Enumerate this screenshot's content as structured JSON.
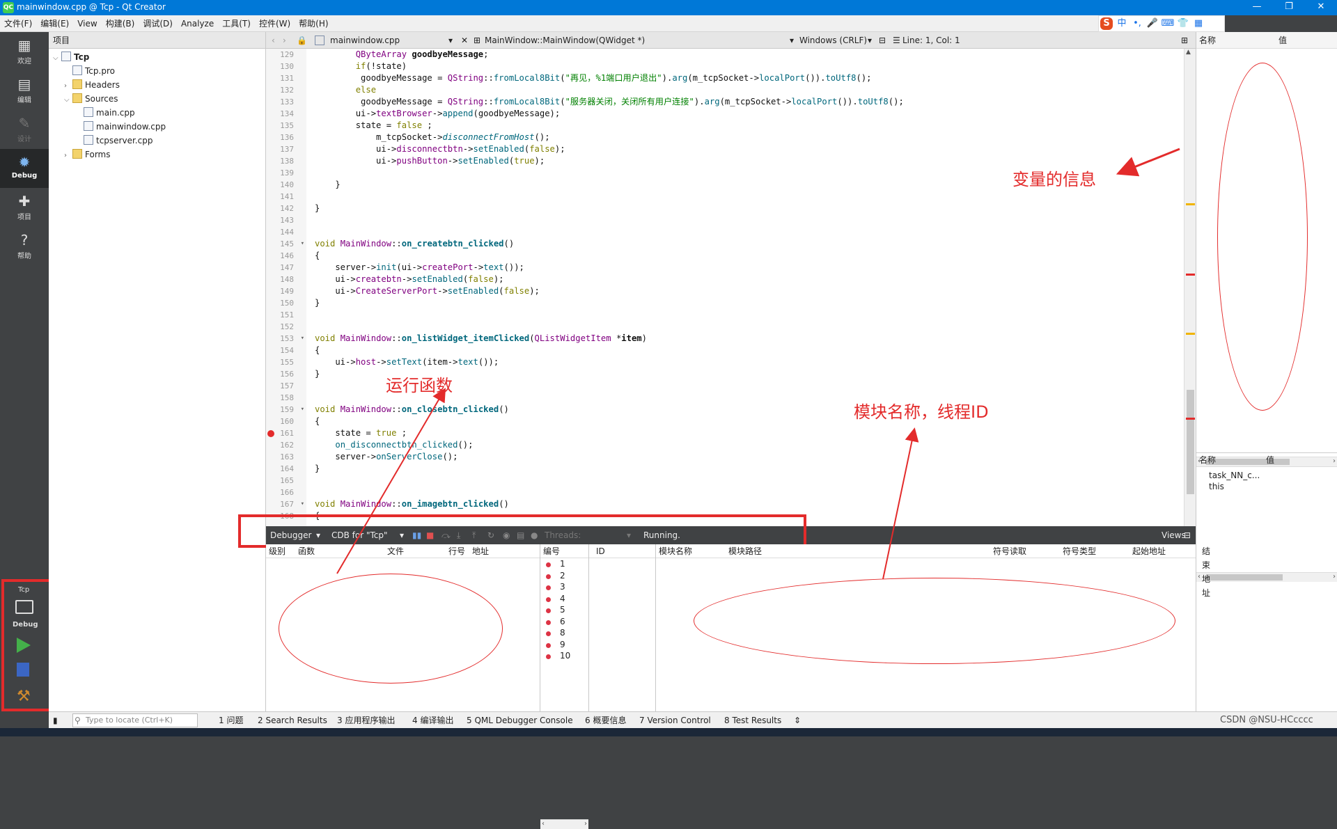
{
  "window": {
    "title": "mainwindow.cpp @ Tcp - Qt Creator",
    "logo": "QC",
    "minimize": "—",
    "restore": "❐",
    "close": "✕"
  },
  "ime": {
    "logo": "S",
    "items": [
      "中",
      "•,",
      "🎤",
      "⌨",
      "👕",
      "▦"
    ]
  },
  "menu": [
    "文件(F)",
    "编辑(E)",
    "View",
    "构建(B)",
    "调试(D)",
    "Analyze",
    "工具(T)",
    "控件(W)",
    "帮助(H)"
  ],
  "modes": [
    {
      "label": "欢迎",
      "icon": "grid-icon"
    },
    {
      "label": "编辑",
      "icon": "edit-icon"
    },
    {
      "label": "设计",
      "icon": "pen-icon"
    },
    {
      "label": "Debug",
      "icon": "bug-icon"
    },
    {
      "label": "项目",
      "icon": "wrench-icon"
    },
    {
      "label": "帮助",
      "icon": "help-icon"
    }
  ],
  "kit": {
    "project": "Tcp",
    "mode": "Debug"
  },
  "project_panel": {
    "title": "项目",
    "tree": [
      {
        "label": "Tcp",
        "depth": 0,
        "arrow": "⌵",
        "bold": true
      },
      {
        "label": "Tcp.pro",
        "depth": 1,
        "arrow": ""
      },
      {
        "label": "Headers",
        "depth": 1,
        "arrow": "›"
      },
      {
        "label": "Sources",
        "depth": 1,
        "arrow": "⌵"
      },
      {
        "label": "main.cpp",
        "depth": 2,
        "arrow": ""
      },
      {
        "label": "mainwindow.cpp",
        "depth": 2,
        "arrow": ""
      },
      {
        "label": "tcpserver.cpp",
        "depth": 2,
        "arrow": ""
      },
      {
        "label": "Forms",
        "depth": 1,
        "arrow": "›"
      }
    ]
  },
  "editor": {
    "file_tab": "mainwindow.cpp",
    "symbol": "MainWindow::MainWindow(QWidget *)",
    "line_endings": "Windows (CRLF)",
    "position": "Line: 1, Col: 1",
    "lines": [
      {
        "n": "129",
        "fold": "",
        "bp": false,
        "code": "        <span class='t'>QByteArray</span> <span class='b'>goodbyeMessage</span>;"
      },
      {
        "n": "130",
        "fold": "",
        "bp": false,
        "code": "        <span class='k'>if</span>(!state)"
      },
      {
        "n": "131",
        "fold": "",
        "bp": false,
        "code": "         goodbyeMessage = <span class='t'>QString</span>::<span class='f'>fromLocal8Bit</span>(<span class='s'>\"再见，%1端口用户退出\"</span>).<span class='f'>arg</span>(m_tcpSocket-&gt;<span class='f'>localPort</span>()).<span class='f'>toUtf8</span>();"
      },
      {
        "n": "132",
        "fold": "",
        "bp": false,
        "code": "        <span class='k'>else</span>"
      },
      {
        "n": "133",
        "fold": "",
        "bp": false,
        "code": "         goodbyeMessage = <span class='t'>QString</span>::<span class='f'>fromLocal8Bit</span>(<span class='s'>\"服务器关闭，关闭所有用户连接\"</span>).<span class='f'>arg</span>(m_tcpSocket-&gt;<span class='f'>localPort</span>()).<span class='f'>toUtf8</span>();"
      },
      {
        "n": "134",
        "fold": "",
        "bp": false,
        "code": "        ui-&gt;<span class='p'>textBrowser</span>-&gt;<span class='f'>append</span>(goodbyeMessage);"
      },
      {
        "n": "135",
        "fold": "",
        "bp": false,
        "code": "        state = <span class='k'>false</span> ;"
      },
      {
        "n": "136",
        "fold": "",
        "bp": false,
        "code": "            m_tcpSocket-&gt;<span class='f it'>disconnectFromHost</span>();"
      },
      {
        "n": "137",
        "fold": "",
        "bp": false,
        "code": "            ui-&gt;<span class='p'>disconnectbtn</span>-&gt;<span class='f'>setEnabled</span>(<span class='k'>false</span>);"
      },
      {
        "n": "138",
        "fold": "",
        "bp": false,
        "code": "            ui-&gt;<span class='p'>pushButton</span>-&gt;<span class='f'>setEnabled</span>(<span class='k'>true</span>);"
      },
      {
        "n": "139",
        "fold": "",
        "bp": false,
        "code": ""
      },
      {
        "n": "140",
        "fold": "",
        "bp": false,
        "code": "    }"
      },
      {
        "n": "141",
        "fold": "",
        "bp": false,
        "code": ""
      },
      {
        "n": "142",
        "fold": "",
        "bp": false,
        "code": "}"
      },
      {
        "n": "143",
        "fold": "",
        "bp": false,
        "code": ""
      },
      {
        "n": "144",
        "fold": "",
        "bp": false,
        "code": ""
      },
      {
        "n": "145",
        "fold": "▾",
        "bp": false,
        "code": "<span class='k'>void</span> <span class='t'>MainWindow</span>::<span class='b f'>on_createbtn_clicked</span>()"
      },
      {
        "n": "146",
        "fold": "",
        "bp": false,
        "code": "{"
      },
      {
        "n": "147",
        "fold": "",
        "bp": false,
        "code": "    server-&gt;<span class='f'>init</span>(ui-&gt;<span class='p'>createPort</span>-&gt;<span class='f'>text</span>());"
      },
      {
        "n": "148",
        "fold": "",
        "bp": false,
        "code": "    ui-&gt;<span class='p'>createbtn</span>-&gt;<span class='f'>setEnabled</span>(<span class='k'>false</span>);"
      },
      {
        "n": "149",
        "fold": "",
        "bp": false,
        "code": "    ui-&gt;<span class='p'>CreateServerPort</span>-&gt;<span class='f'>setEnabled</span>(<span class='k'>false</span>);"
      },
      {
        "n": "150",
        "fold": "",
        "bp": false,
        "code": "}"
      },
      {
        "n": "151",
        "fold": "",
        "bp": false,
        "code": ""
      },
      {
        "n": "152",
        "fold": "",
        "bp": false,
        "code": ""
      },
      {
        "n": "153",
        "fold": "▾",
        "bp": false,
        "code": "<span class='k'>void</span> <span class='t'>MainWindow</span>::<span class='b f'>on_listWidget_itemClicked</span>(<span class='t'>QListWidgetItem</span> *<span class='b'>item</span>)"
      },
      {
        "n": "154",
        "fold": "",
        "bp": false,
        "code": "{"
      },
      {
        "n": "155",
        "fold": "",
        "bp": false,
        "code": "    ui-&gt;<span class='p'>host</span>-&gt;<span class='f'>setText</span>(item-&gt;<span class='f'>text</span>());"
      },
      {
        "n": "156",
        "fold": "",
        "bp": false,
        "code": "}"
      },
      {
        "n": "157",
        "fold": "",
        "bp": false,
        "code": ""
      },
      {
        "n": "158",
        "fold": "",
        "bp": false,
        "code": ""
      },
      {
        "n": "159",
        "fold": "▾",
        "bp": false,
        "code": "<span class='k'>void</span> <span class='t'>MainWindow</span>::<span class='b f'>on_closebtn_clicked</span>()"
      },
      {
        "n": "160",
        "fold": "",
        "bp": false,
        "code": "{"
      },
      {
        "n": "161",
        "fold": "",
        "bp": true,
        "code": "    state = <span class='k'>true</span> ;"
      },
      {
        "n": "162",
        "fold": "",
        "bp": false,
        "code": "    <span class='f'>on_disconnectbtn_clicked</span>();"
      },
      {
        "n": "163",
        "fold": "",
        "bp": false,
        "code": "    server-&gt;<span class='f'>onServerClose</span>();"
      },
      {
        "n": "164",
        "fold": "",
        "bp": false,
        "code": "}"
      },
      {
        "n": "165",
        "fold": "",
        "bp": false,
        "code": ""
      },
      {
        "n": "166",
        "fold": "",
        "bp": false,
        "code": ""
      },
      {
        "n": "167",
        "fold": "▾",
        "bp": false,
        "code": "<span class='k'>void</span> <span class='t'>MainWindow</span>::<span class='b f'>on_imagebtn_clicked</span>()"
      },
      {
        "n": "168",
        "fold": "",
        "bp": false,
        "code": "{"
      }
    ]
  },
  "right_panel": {
    "col_name": "名称",
    "col_value": "值",
    "locals": [
      {
        "name": "task_NN_c...",
        "value": ""
      },
      {
        "name": "this",
        "value": ""
      }
    ]
  },
  "debug_bar": {
    "debugger": "Debugger",
    "engine": "CDB for \"Tcp\"",
    "threads": "Threads:",
    "status": "Running.",
    "views": "Views"
  },
  "stack_pane": {
    "headers": [
      "级别",
      "函数",
      "文件",
      "行号",
      "地址"
    ]
  },
  "breakpoints": {
    "header": "编号",
    "items": [
      "1",
      "2",
      "3",
      "4",
      "5",
      "6",
      "8",
      "9",
      "10"
    ]
  },
  "threads_pane": {
    "header": "ID"
  },
  "modules_pane": {
    "headers": [
      "模块名称",
      "模块路径",
      "符号读取",
      "符号类型",
      "起始地址",
      "结束地址"
    ]
  },
  "statusbar": {
    "locate_placeholder": "Type to locate (Ctrl+K)",
    "tabs": [
      "1 问题",
      "2 Search Results",
      "3 应用程序输出",
      "4 编译输出",
      "5 QML Debugger Console",
      "6 概要信息",
      "7 Version Control",
      "8 Test Results"
    ],
    "watermark": "CSDN @NSU-HCcccc"
  },
  "annotations": {
    "variables": "变量的信息",
    "run_function": "运行函数",
    "modules": "模块名称，线程ID"
  },
  "colors": {
    "annotation": "#e32b2b",
    "titlebar": "#0078d7"
  }
}
